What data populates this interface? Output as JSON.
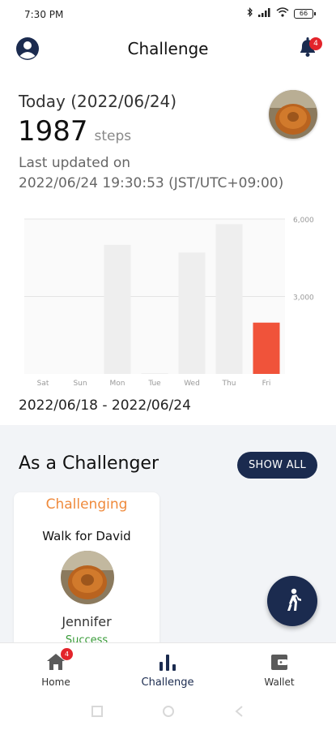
{
  "status_bar": {
    "time": "7:30 PM",
    "battery": "66"
  },
  "header": {
    "title": "Challenge",
    "notification_count": "4"
  },
  "today": {
    "label": "Today (2022/06/24)",
    "steps": "1987",
    "steps_unit": "steps",
    "updated_label": "Last updated on",
    "updated_time": "2022/06/24 19:30:53 (JST/UTC+09:00)"
  },
  "chart_data": {
    "type": "bar",
    "categories": [
      "Sat",
      "Sun",
      "Mon",
      "Tue",
      "Wed",
      "Thu",
      "Fri"
    ],
    "values": [
      0,
      0,
      5000,
      30,
      4700,
      5800,
      1987
    ],
    "highlight_index": 6,
    "highlight_color": "#f0533a",
    "bar_color": "#eeeeee",
    "y_ticks": [
      "6,000",
      "3,000"
    ],
    "ylim": [
      0,
      6000
    ],
    "grid": true
  },
  "date_range": "2022/06/18 - 2022/06/24",
  "challenger": {
    "title": "As a Challenger",
    "show_all": "SHOW ALL",
    "card": {
      "status": "Challenging",
      "title": "Walk for David",
      "name": "Jennifer",
      "result": "Success"
    }
  },
  "fab": {
    "icon": "walking-person-icon"
  },
  "bottom_nav": {
    "items": [
      {
        "label": "Home",
        "icon": "home-icon",
        "badge": "4"
      },
      {
        "label": "Challenge",
        "icon": "bar-chart-icon"
      },
      {
        "label": "Wallet",
        "icon": "wallet-icon"
      }
    ]
  },
  "colors": {
    "navy": "#1b2b4f",
    "orange": "#ef8a3c",
    "red": "#f0533a",
    "success": "#3a9c3a"
  }
}
